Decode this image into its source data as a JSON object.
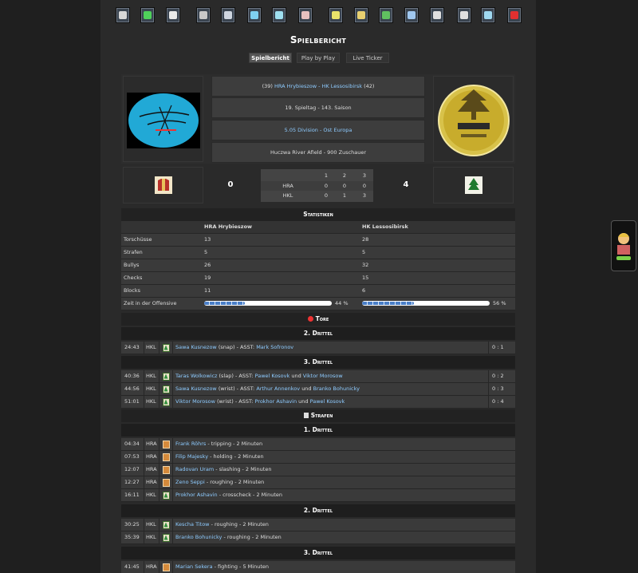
{
  "nav_icons": [
    {
      "name": "home-icon",
      "color": "#d7d7d7"
    },
    {
      "name": "shirt-icon",
      "color": "#4fd05a"
    },
    {
      "name": "lineup-icon",
      "color": "#e9e9e9"
    },
    {
      "name": "training-icon",
      "color": "#c8c8c8"
    },
    {
      "name": "list-icon",
      "color": "#cfd6e0"
    },
    {
      "name": "stats-icon",
      "color": "#7fd0f0"
    },
    {
      "name": "transfer-icon",
      "color": "#9fe0f0"
    },
    {
      "name": "arena-icon",
      "color": "#e6c0c0"
    },
    {
      "name": "trophy-icon",
      "color": "#e8e36a"
    },
    {
      "name": "office-icon",
      "color": "#e8d070"
    },
    {
      "name": "exchange-icon",
      "color": "#60c060"
    },
    {
      "name": "chart-icon",
      "color": "#a0c8f0"
    },
    {
      "name": "mail-icon",
      "color": "#e0e0e0"
    },
    {
      "name": "news-icon",
      "color": "#e0e0e0"
    },
    {
      "name": "chat-icon",
      "color": "#9fd8f0"
    },
    {
      "name": "logout-icon",
      "color": "#e03030"
    }
  ],
  "page_title": "Spielbericht",
  "tabs": [
    "Spielbericht",
    "Play by Play",
    "Live Ticker"
  ],
  "header": {
    "home_rank": "(39)",
    "matchup": "HRA Hrybieszow - HK Lessosibirsk",
    "away_rank": "(42)",
    "round": "19. Spieltag - 143. Saison",
    "division": "5.05 Division - Ost Europa",
    "venue": "Huczwa River Afield - 900 Zuschauer"
  },
  "score": {
    "home": "0",
    "away": "4",
    "periods": [
      "1",
      "2",
      "3"
    ],
    "rows": [
      {
        "team": "HRA",
        "p": [
          "0",
          "0",
          "0"
        ]
      },
      {
        "team": "HKL",
        "p": [
          "0",
          "1",
          "3"
        ]
      }
    ]
  },
  "stats": {
    "title": "Statistiken",
    "home_team": "HRA Hrybieszow",
    "away_team": "HK Lessosibirsk",
    "rows": [
      {
        "label": "Torschüsse",
        "home": "13",
        "away": "28"
      },
      {
        "label": "Strafen",
        "home": "5",
        "away": "5"
      },
      {
        "label": "Bullys",
        "home": "26",
        "away": "32"
      },
      {
        "label": "Checks",
        "home": "19",
        "away": "15"
      },
      {
        "label": "Blocks",
        "home": "11",
        "away": "6"
      }
    ],
    "offense_label": "Zeit in der Offensive",
    "offense_home": "44 %",
    "offense_away": "56 %",
    "offense_home_value": 44,
    "offense_away_value": 56
  },
  "goals": {
    "title": "Tore",
    "sections": [
      {
        "period": "2. Drittel",
        "items": [
          {
            "time": "24:43",
            "team": "HKL",
            "scorer": "Sawa Kusnezow",
            "type": " (snap) - ASST: ",
            "a1": "Mark Sofronov",
            "and": "",
            "a2": "",
            "result": "0 : 1"
          }
        ]
      },
      {
        "period": "3. Drittel",
        "items": [
          {
            "time": "40:36",
            "team": "HKL",
            "scorer": "Taras Wolkowicz",
            "type": " (slap) - ASST: ",
            "a1": "Pawel Kosovk",
            "and": " und ",
            "a2": "Viktor Morosow",
            "result": "0 : 2"
          },
          {
            "time": "44:56",
            "team": "HKL",
            "scorer": "Sawa Kusnezow",
            "type": " (wrist) - ASST: ",
            "a1": "Arthur Annenkov",
            "and": " und ",
            "a2": "Branko Bohunicky",
            "result": "0 : 3"
          },
          {
            "time": "51:01",
            "team": "HKL",
            "scorer": "Viktor Morosow",
            "type": " (wrist) - ASST: ",
            "a1": "Prokhor Ashavin",
            "and": " und ",
            "a2": "Pawel Kosovk",
            "result": "0 : 4"
          }
        ]
      }
    ]
  },
  "penalties": {
    "title": "Strafen",
    "sections": [
      {
        "period": "1. Drittel",
        "items": [
          {
            "time": "04:34",
            "team": "HRA",
            "player": "Frank Röhrs",
            "desc": " - tripping - 2 Minuten"
          },
          {
            "time": "07:53",
            "team": "HRA",
            "player": "Filip Majesky",
            "desc": " - holding - 2 Minuten"
          },
          {
            "time": "12:07",
            "team": "HRA",
            "player": "Radovan Uram",
            "desc": " - slashing - 2 Minuten"
          },
          {
            "time": "12:27",
            "team": "HRA",
            "player": "Zeno Seppi",
            "desc": " - roughing - 2 Minuten"
          },
          {
            "time": "16:11",
            "team": "HKL",
            "player": "Prokhor Ashavin",
            "desc": " - crosscheck - 2 Minuten"
          }
        ]
      },
      {
        "period": "2. Drittel",
        "items": [
          {
            "time": "30:25",
            "team": "HKL",
            "player": "Kescha Titow",
            "desc": " - roughing - 2 Minuten"
          },
          {
            "time": "35:39",
            "team": "HKL",
            "player": "Branko Bohunicky",
            "desc": " - roughing - 2 Minuten"
          }
        ]
      },
      {
        "period": "3. Drittel",
        "items": [
          {
            "time": "41:45",
            "team": "HRA",
            "player": "Marian Sekera",
            "desc": " - fighting - 5 Minuten"
          }
        ]
      }
    ]
  },
  "colors": {
    "link": "#8ecbff",
    "bar_fill": "#4a7fc8",
    "goal_badge": "#2f8f3a",
    "penalty_badge": "#d58a3b"
  }
}
